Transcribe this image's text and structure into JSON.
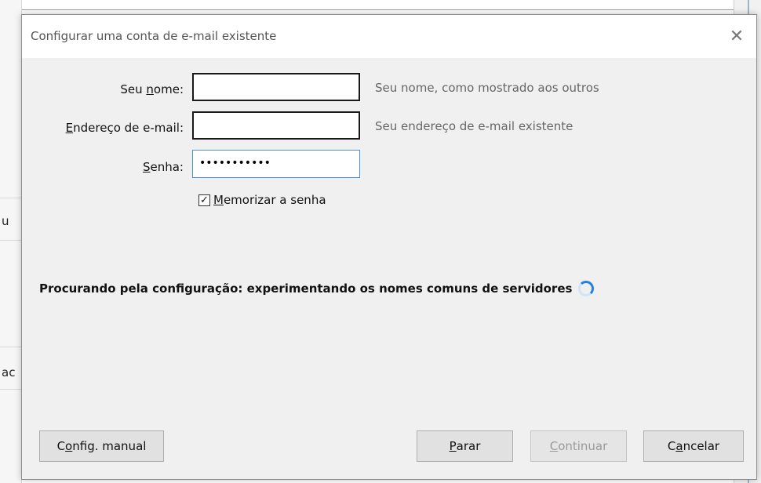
{
  "background": {
    "left_fragments": [
      "u",
      "ac"
    ]
  },
  "dialog": {
    "title": "Configurar uma conta de e-mail existente",
    "close_glyph": "✕"
  },
  "form": {
    "name": {
      "label_pre": "Seu ",
      "label_ul": "n",
      "label_post": "ome:",
      "value": "",
      "hint": "Seu nome, como mostrado aos outros"
    },
    "email": {
      "label_pre": "",
      "label_ul": "E",
      "label_post": "ndereço de e-mail:",
      "value": "",
      "hint": "Seu endereço de e-mail existente"
    },
    "password": {
      "label_pre": "",
      "label_ul": "S",
      "label_post": "enha:",
      "masked_value": "•••••••••••"
    },
    "remember": {
      "checked": true,
      "check_glyph": "✓",
      "label_ul": "M",
      "label_post": "emorizar a senha"
    }
  },
  "status": {
    "text": "Procurando pela configuração: experimentando os nomes comuns de servidores",
    "icon": "spinner-icon"
  },
  "buttons": {
    "manual": {
      "pre": "C",
      "ul": "o",
      "post": "nfig. manual"
    },
    "stop": {
      "pre": "",
      "ul": "P",
      "post": "arar"
    },
    "continue": {
      "pre": "",
      "ul": "C",
      "post": "ontinuar",
      "disabled": true
    },
    "cancel": {
      "pre": "C",
      "ul": "a",
      "post": "ncelar"
    }
  },
  "colors": {
    "focus_border": "#4b8fd6",
    "spinner": "#2a7fde"
  }
}
